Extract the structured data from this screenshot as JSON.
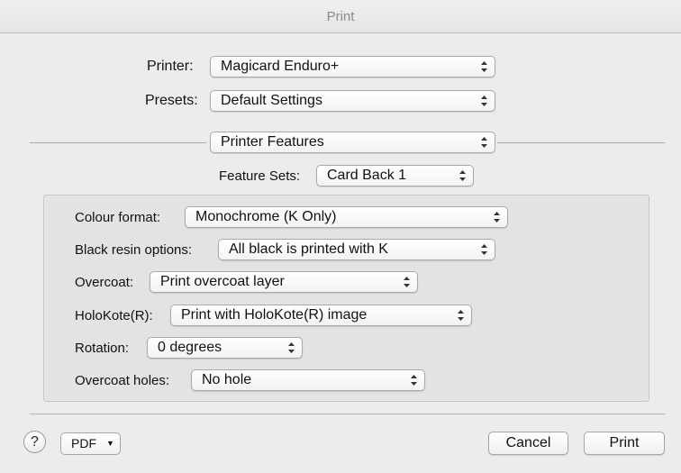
{
  "window": {
    "title": "Print"
  },
  "printer": {
    "label": "Printer:",
    "value": "Magicard Enduro+"
  },
  "presets": {
    "label": "Presets:",
    "value": "Default Settings"
  },
  "section": {
    "value": "Printer Features"
  },
  "feature_sets": {
    "label": "Feature Sets:",
    "value": "Card Back 1"
  },
  "options": [
    {
      "label": "Colour format:",
      "value": "Monochrome (K Only)"
    },
    {
      "label": "Black resin options:",
      "value": "All black is printed with K"
    },
    {
      "label": "Overcoat:",
      "value": "Print overcoat layer"
    },
    {
      "label": "HoloKote(R):",
      "value": "Print with HoloKote(R) image"
    },
    {
      "label": "Rotation:",
      "value": "0 degrees"
    },
    {
      "label": "Overcoat holes:",
      "value": "No hole"
    }
  ],
  "footer": {
    "help": "?",
    "pdf": "PDF",
    "pdf_caret": "▼",
    "cancel": "Cancel",
    "print": "Print"
  },
  "icons": {
    "popup_arrows": "updown-arrows-icon",
    "help": "help-icon",
    "pdf_menu": "chevron-down-icon"
  }
}
